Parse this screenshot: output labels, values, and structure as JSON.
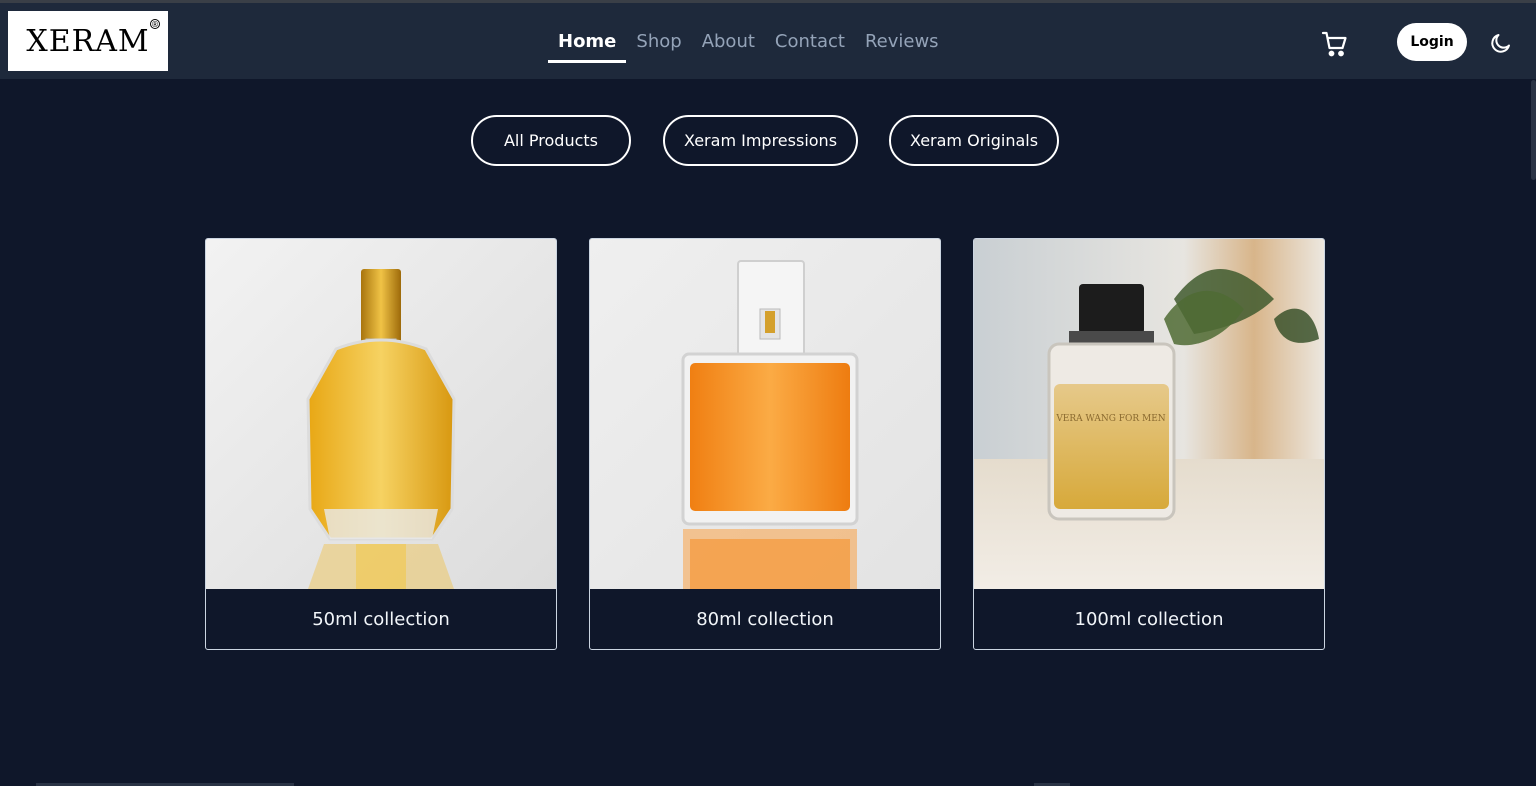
{
  "brand": {
    "logo_text": "XERAM",
    "reg_mark": "®"
  },
  "nav": {
    "links": [
      {
        "label": "Home",
        "active": true
      },
      {
        "label": "Shop",
        "active": false
      },
      {
        "label": "About",
        "active": false
      },
      {
        "label": "Contact",
        "active": false
      },
      {
        "label": "Reviews",
        "active": false
      }
    ],
    "cart_icon": "cart-icon",
    "login_label": "Login",
    "theme_icon": "moon-icon"
  },
  "filters": [
    {
      "label": "All Products"
    },
    {
      "label": "Xeram Impressions"
    },
    {
      "label": "Xeram Originals"
    }
  ],
  "products": [
    {
      "label": "50ml collection"
    },
    {
      "label": "80ml collection"
    },
    {
      "label": "100ml collection",
      "bottle_text": "VERA WANG FOR MEN"
    }
  ],
  "colors": {
    "page_bg": "#0f172a",
    "navbar_bg": "#1e293b",
    "nav_inactive": "#94a3b8",
    "accent": "#ffffff"
  }
}
